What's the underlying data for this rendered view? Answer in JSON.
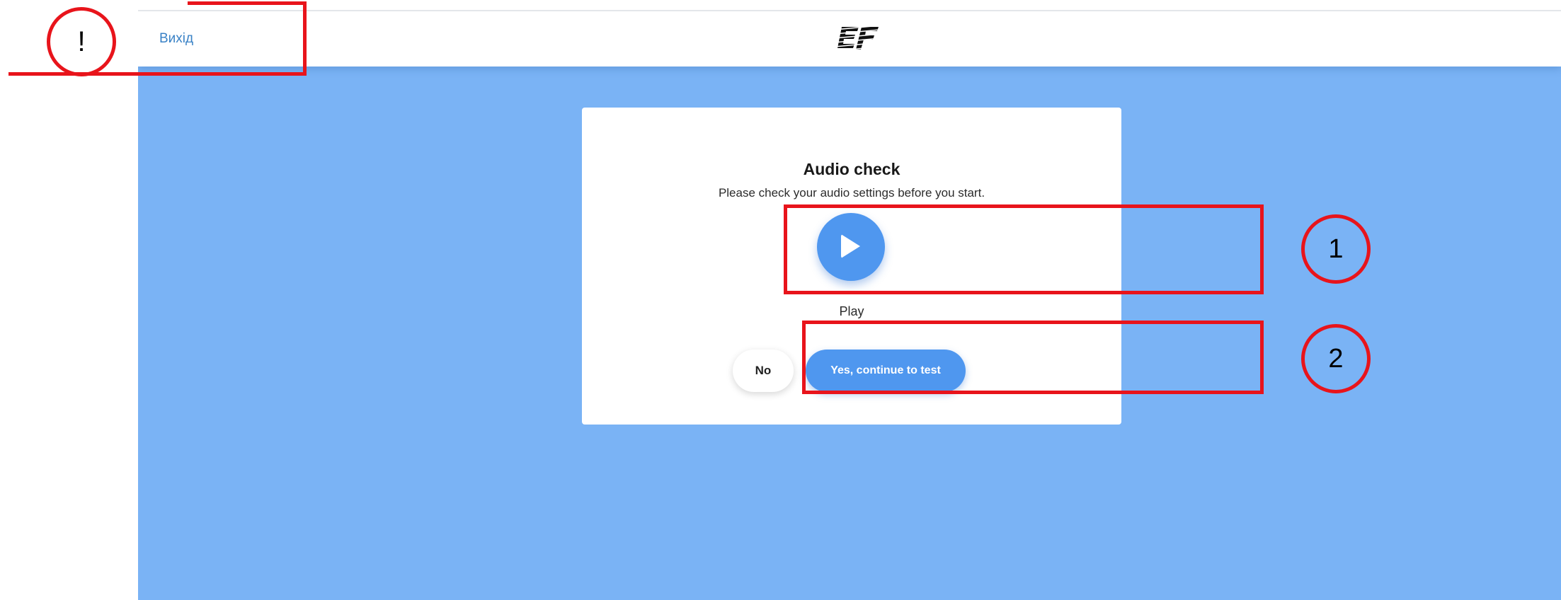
{
  "topbar": {
    "exit_label": "Вихід",
    "logo_name": "ef-logo"
  },
  "audio_check": {
    "title": "Audio check",
    "subtitle": "Please check your audio settings before you start.",
    "play_label": "Play",
    "no_label": "No",
    "yes_label": "Yes, continue to test"
  },
  "annotations": {
    "warning_marker": "!",
    "marker_1": "1",
    "marker_2": "2"
  },
  "colors": {
    "page_background": "#7ab3f5",
    "accent_blue": "#4f97ef",
    "link_blue": "#3a82c6",
    "annotation_red": "#e8141b"
  }
}
